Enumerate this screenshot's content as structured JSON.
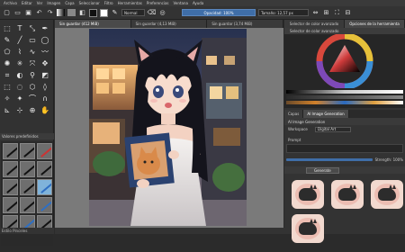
{
  "menu": [
    "Archivo",
    "Editar",
    "Ver",
    "Imagen",
    "Capa",
    "Seleccionar",
    "Filtro",
    "Herramientas",
    "Preferencias",
    "Ventana",
    "Ayuda"
  ],
  "toolbar": {
    "blend_mode": "Normal",
    "opacity_label": "Opacidad: 100%",
    "size_label": "Tamaño: 12,57 px"
  },
  "document_tabs": [
    "Sin guardar (412 MiB)",
    "Sin guardar (4,13 MiB)",
    "Sin guardar (3,74 MiB)"
  ],
  "left_panel": {
    "brush_presets_header": "Valores predefinidos",
    "status": "Estilo Pinceles"
  },
  "right_dock": {
    "tabs": [
      "Selector de color avanzado",
      "Opciones de la herramienta"
    ],
    "selector_label": "Selector de color avanzado",
    "panel2_tabs": [
      "Capas",
      "AI Image Generation"
    ],
    "ai_header": "AI Image Generation",
    "workspace_label": "Workspace",
    "model_value": "Digital Art",
    "prompt_label": "Prompt",
    "strength_label": "Strength: 100%",
    "generate_label": "Generate"
  },
  "colors": {
    "accent": "#3f6ea8",
    "panel_bg": "#333333",
    "canvas_bg": "#7a7a7a"
  }
}
